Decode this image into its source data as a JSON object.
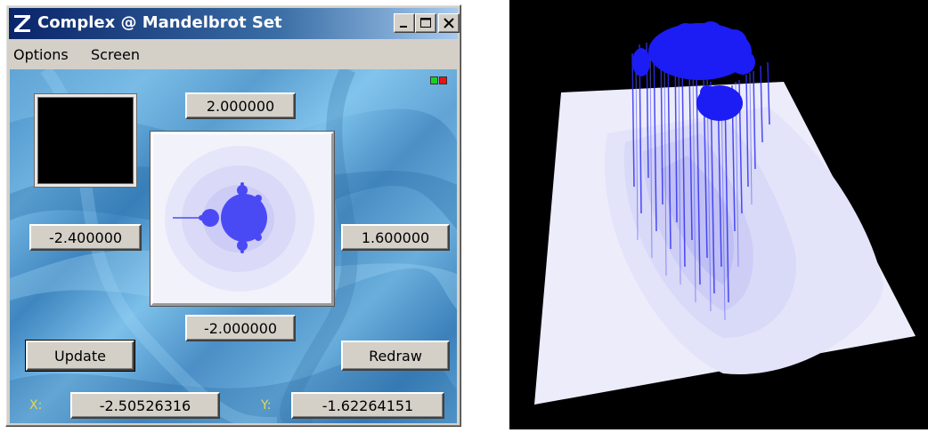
{
  "window": {
    "title": "Complex @ Mandelbrot Set",
    "controls": {
      "minimize": "minimize",
      "maximize": "maximize",
      "close": "close"
    }
  },
  "menu": {
    "items": [
      {
        "label": "Options"
      },
      {
        "label": "Screen"
      }
    ]
  },
  "bounds": {
    "top": "2.000000",
    "left": "-2.400000",
    "right": "1.600000",
    "bottom": "-2.000000"
  },
  "actions": {
    "update_label": "Update",
    "redraw_label": "Redraw"
  },
  "cursor": {
    "x_label": "X:",
    "x_value": "-2.50526316",
    "y_label": "Y:",
    "y_value": "-1.62264151"
  },
  "colors": {
    "titlebar_start": "#0a246a",
    "titlebar_end": "#a6caf0",
    "fractal_blue": "#3a3af5",
    "indicator_green": "#22cc22",
    "indicator_red": "#ee1111",
    "label_yellow": "#e6d84a",
    "view_background": "#000000",
    "plane_color": "#e9e9fa"
  },
  "icons": {
    "app": "z-logo-icon",
    "minimize": "minimize-icon",
    "maximize": "maximize-icon",
    "close": "close-icon"
  }
}
